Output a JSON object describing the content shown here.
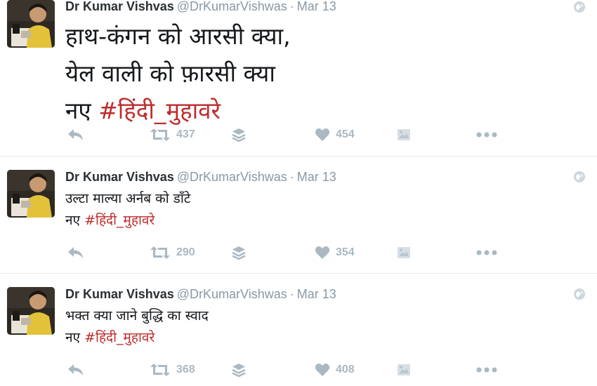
{
  "colors": {
    "hashtag": "#bd2c2c",
    "name": "#292f33",
    "meta": "#8899a6",
    "action_icon": "#aab8c2",
    "divider": "#e1e8ed"
  },
  "icons": [
    "reply-icon",
    "retweet-icon",
    "stack-icon",
    "heart-icon",
    "media-icon",
    "more-icon",
    "globe-icon"
  ],
  "tweets": [
    {
      "author": {
        "name": "Dr Kumar Vishvas",
        "handle": "@DrKumarVishwas"
      },
      "separator": "·",
      "date": "Mar 13",
      "lines": [
        "हाथ-कंगन को आरसी क्या,",
        "येल वाली को फ़ारसी क्या"
      ],
      "prefix": "नए",
      "hashtag": "#हिंदी_मुहावरे",
      "retweets": "437",
      "likes": "454"
    },
    {
      "author": {
        "name": "Dr Kumar Vishvas",
        "handle": "@DrKumarVishwas"
      },
      "separator": "·",
      "date": "Mar 13",
      "lines": [
        "उल्टा माल्या अर्नब को डाँटे"
      ],
      "prefix": "नए",
      "hashtag": "#हिंदी_मुहावरे",
      "retweets": "290",
      "likes": "354"
    },
    {
      "author": {
        "name": "Dr Kumar Vishvas",
        "handle": "@DrKumarVishwas"
      },
      "separator": "·",
      "date": "Mar 13",
      "lines": [
        "भक्त क्या जाने बुद्धि का स्वाद"
      ],
      "prefix": "नए",
      "hashtag": "#हिंदी_मुहावरे",
      "retweets": "368",
      "likes": "408"
    }
  ]
}
